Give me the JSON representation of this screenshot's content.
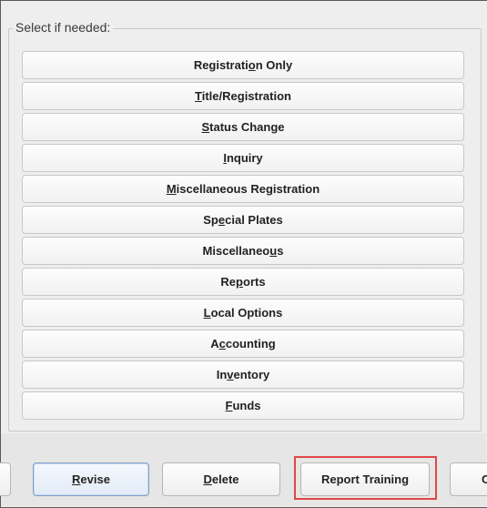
{
  "group": {
    "legend": "Select if needed:"
  },
  "menu_buttons": [
    {
      "before": "Registrati",
      "mnemonic": "o",
      "after": "n Only"
    },
    {
      "before": "",
      "mnemonic": "T",
      "after": "itle/Registration"
    },
    {
      "before": "",
      "mnemonic": "S",
      "after": "tatus Change"
    },
    {
      "before": "",
      "mnemonic": "I",
      "after": "nquiry"
    },
    {
      "before": "",
      "mnemonic": "M",
      "after": "iscellaneous Registration"
    },
    {
      "before": "Sp",
      "mnemonic": "e",
      "after": "cial Plates"
    },
    {
      "before": "Miscellaneo",
      "mnemonic": "u",
      "after": "s"
    },
    {
      "before": "Re",
      "mnemonic": "p",
      "after": "orts"
    },
    {
      "before": "",
      "mnemonic": "L",
      "after": "ocal Options"
    },
    {
      "before": "A",
      "mnemonic": "c",
      "after": "counting"
    },
    {
      "before": "In",
      "mnemonic": "v",
      "after": "entory"
    },
    {
      "before": "",
      "mnemonic": "F",
      "after": "unds"
    }
  ],
  "bottom": {
    "revise": {
      "mnemonic": "R",
      "after": "evise"
    },
    "delete": {
      "mnemonic": "D",
      "after": "elete"
    },
    "report_training": "Report Training",
    "partial_right": "C"
  },
  "colors": {
    "highlight": "#e04848",
    "focus_border": "#7fa0c8"
  }
}
